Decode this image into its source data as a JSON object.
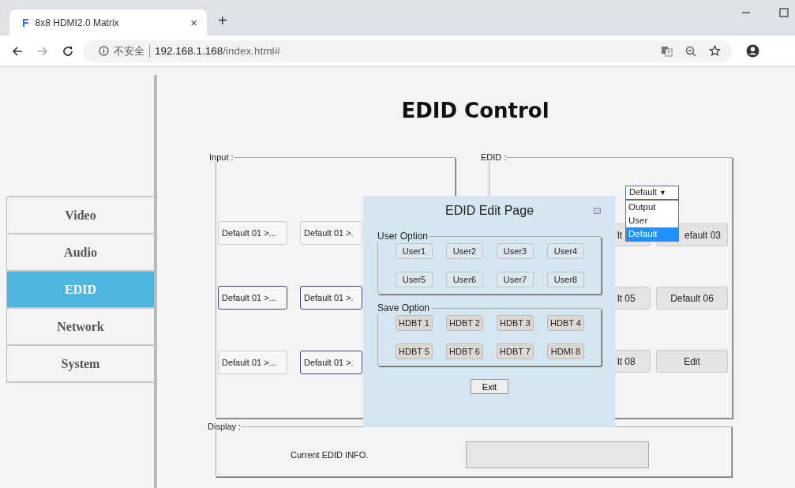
{
  "browser": {
    "tab_favicon": "F",
    "tab_title": "8x8 HDMI2.0 Matrix",
    "tab_close": "×",
    "new_tab": "+",
    "security_label": "不安全",
    "url_host": "192.168.1.168",
    "url_path": "/index.html#"
  },
  "sidebar": {
    "items": [
      {
        "label": "Video",
        "selected": false
      },
      {
        "label": "Audio",
        "selected": false
      },
      {
        "label": "EDID",
        "selected": true
      },
      {
        "label": "Network",
        "selected": false
      },
      {
        "label": "System",
        "selected": false
      }
    ]
  },
  "page_title": "EDID Control",
  "input_panel": {
    "legend": "Input :",
    "rows": [
      {
        "buttons": [
          {
            "label": "Default 01 >...",
            "highlighted": false
          },
          {
            "label": "Default 01 >.",
            "highlighted": false
          }
        ]
      },
      {
        "buttons": [
          {
            "label": "Default 01 >...",
            "highlighted": true
          },
          {
            "label": "Default 01 >.",
            "highlighted": true
          }
        ]
      },
      {
        "buttons": [
          {
            "label": "Default 01 >...",
            "highlighted": false
          },
          {
            "label": "Default 01 >.",
            "highlighted": true
          }
        ]
      }
    ]
  },
  "edid_panel": {
    "legend": "EDID :",
    "mode_select": {
      "value": "Default",
      "arrow": "▼",
      "expanded": true,
      "options": [
        {
          "label": "Output",
          "selected": false
        },
        {
          "label": "User",
          "selected": false
        },
        {
          "label": "Default",
          "selected": true
        }
      ]
    },
    "rows": [
      {
        "buttons": [
          "lt",
          "efault 03"
        ]
      },
      {
        "buttons": [
          "lt 05",
          "Default 06"
        ]
      },
      {
        "buttons": [
          "lt 08",
          "Edit"
        ]
      }
    ]
  },
  "display_panel": {
    "legend": "Display :",
    "info_label": "Current EDID INFO."
  },
  "dialog": {
    "title": "EDID Edit Page",
    "user_option": {
      "legend": "User Option",
      "buttons": [
        "User1",
        "User2",
        "User3",
        "User4",
        "User5",
        "User6",
        "User7",
        "User8"
      ]
    },
    "save_option": {
      "legend": "Save Option",
      "buttons": [
        "HDBT 1",
        "HDBT 2",
        "HDBT 3",
        "HDBT 4",
        "HDBT 5",
        "HDBT 6",
        "HDBT 7",
        "HDMI 8"
      ]
    },
    "exit": "Exit"
  }
}
